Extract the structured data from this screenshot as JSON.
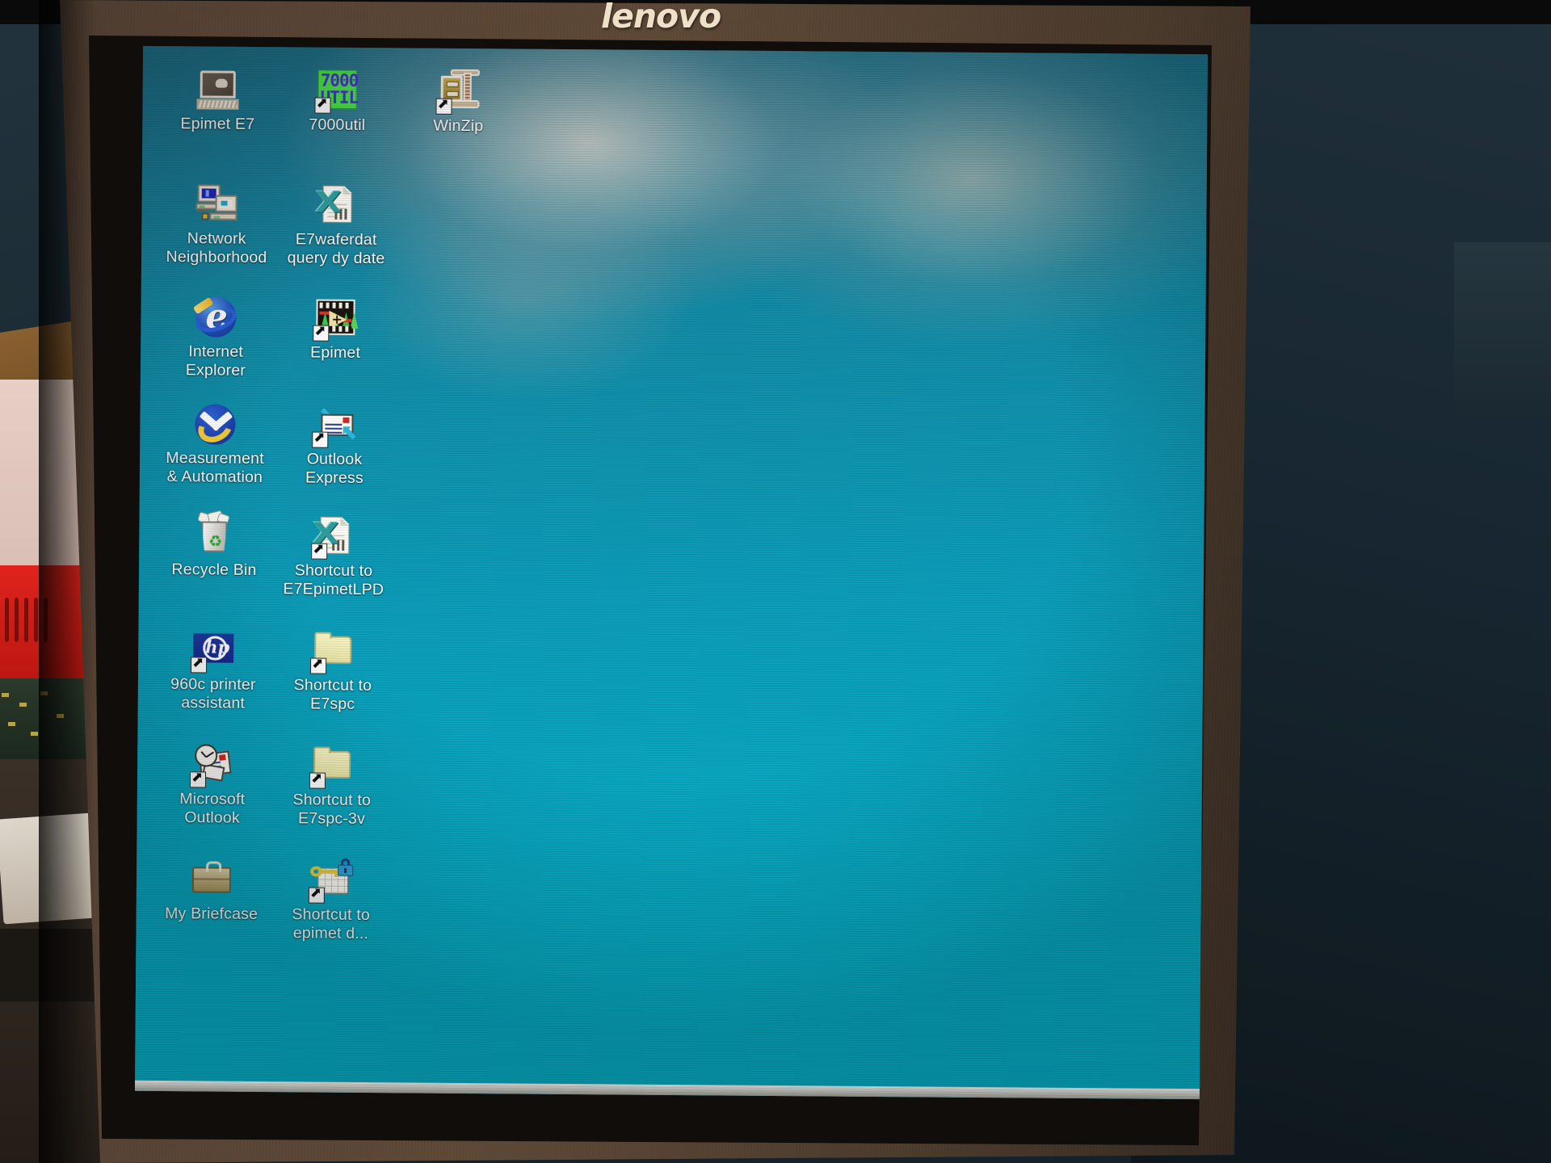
{
  "monitor": {
    "brand": "lenovo",
    "brand_color": "#efe0c8",
    "bezel_color": "#5d4836"
  },
  "screen": {
    "wallpaper_color_top": "#1f6d85",
    "wallpaper_color_bottom": "#06b0c8",
    "label_color": "#ffffff",
    "taskbar_color": "#c9c9c2"
  },
  "desktop": {
    "icons": [
      {
        "label": "Epimet E7",
        "icon": "computer-mouse-icon",
        "shortcut": false,
        "col": 0,
        "row": 0
      },
      {
        "label": "7000util",
        "icon": "7000util-green-tile-icon",
        "shortcut": true,
        "col": 1,
        "row": 0
      },
      {
        "label": "WinZip",
        "icon": "winzip-cabinet-clamp-icon",
        "shortcut": true,
        "col": 2,
        "row": 0
      },
      {
        "label": "Network\nNeighborhood",
        "icon": "network-neighborhood-icon",
        "shortcut": false,
        "col": 0,
        "row": 1
      },
      {
        "label": "E7waferdat\nquery dy date",
        "icon": "excel-document-icon",
        "shortcut": false,
        "col": 1,
        "row": 1
      },
      {
        "label": "Internet\nExplorer",
        "icon": "internet-explorer-icon",
        "shortcut": false,
        "col": 0,
        "row": 2
      },
      {
        "label": "Epimet",
        "icon": "labview-vi-icon",
        "shortcut": true,
        "col": 1,
        "row": 2
      },
      {
        "label": "Measurement\n& Automation",
        "icon": "ni-measurement-automation-icon",
        "shortcut": false,
        "col": 0,
        "row": 3
      },
      {
        "label": "Outlook\nExpress",
        "icon": "outlook-express-icon",
        "shortcut": true,
        "col": 1,
        "row": 3
      },
      {
        "label": "Recycle Bin",
        "icon": "recycle-bin-icon",
        "shortcut": false,
        "col": 0,
        "row": 4
      },
      {
        "label": "Shortcut to\nE7EpimetLPD",
        "icon": "excel-document-icon",
        "shortcut": true,
        "col": 1,
        "row": 4
      },
      {
        "label": "960c printer\nassistant",
        "icon": "hp-logo-icon",
        "shortcut": true,
        "col": 0,
        "row": 5
      },
      {
        "label": "Shortcut to\nE7spc",
        "icon": "folder-icon",
        "shortcut": true,
        "col": 1,
        "row": 5
      },
      {
        "label": "Microsoft\nOutlook",
        "icon": "microsoft-outlook-icon",
        "shortcut": true,
        "col": 0,
        "row": 6
      },
      {
        "label": "Shortcut to\nE7spc-3v",
        "icon": "folder-icon",
        "shortcut": true,
        "col": 1,
        "row": 6
      },
      {
        "label": "My Briefcase",
        "icon": "briefcase-icon",
        "shortcut": false,
        "col": 0,
        "row": 7
      },
      {
        "label": "Shortcut to\nepimet d...",
        "icon": "key-lock-grid-icon",
        "shortcut": true,
        "col": 1,
        "row": 7
      }
    ],
    "tile_7000util": {
      "line1": "7000",
      "line2": "UTIL"
    }
  }
}
